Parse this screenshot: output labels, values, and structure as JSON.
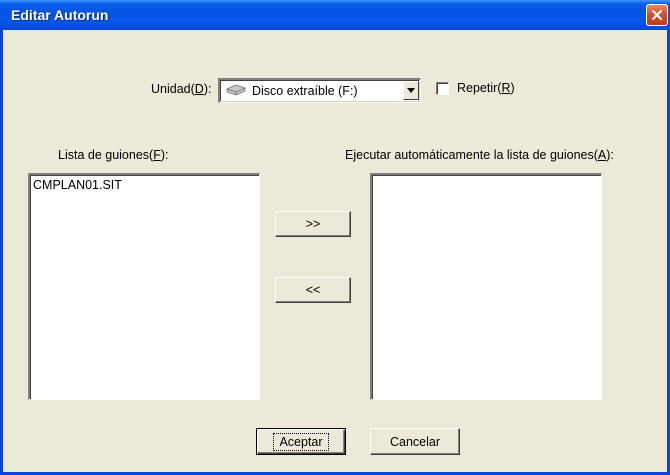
{
  "window": {
    "title": "Editar Autorun"
  },
  "unit": {
    "label_prefix": "Unidad(",
    "label_hotkey": "D",
    "label_suffix": "):",
    "selected_value": "Disco extraíble (F:)",
    "icon": "removable-disk-icon"
  },
  "repeat": {
    "label_prefix": "Repetir(",
    "label_hotkey": "R",
    "label_suffix": ")",
    "checked": false
  },
  "script_list": {
    "label_prefix": "Lista de guiones(",
    "label_hotkey": "F",
    "label_suffix": "):",
    "items": [
      "CMPLAN01.SIT"
    ]
  },
  "autorun_list": {
    "label_prefix": "Ejecutar automáticamente la lista de guiones(",
    "label_hotkey": "A",
    "label_suffix": "):",
    "items": []
  },
  "buttons": {
    "add": ">>",
    "remove": "<<",
    "ok": "Aceptar",
    "cancel": "Cancelar"
  },
  "colors": {
    "titlebar": "#0554e3",
    "dialog_bg": "#ece9d8",
    "close_button": "#d5502d"
  }
}
